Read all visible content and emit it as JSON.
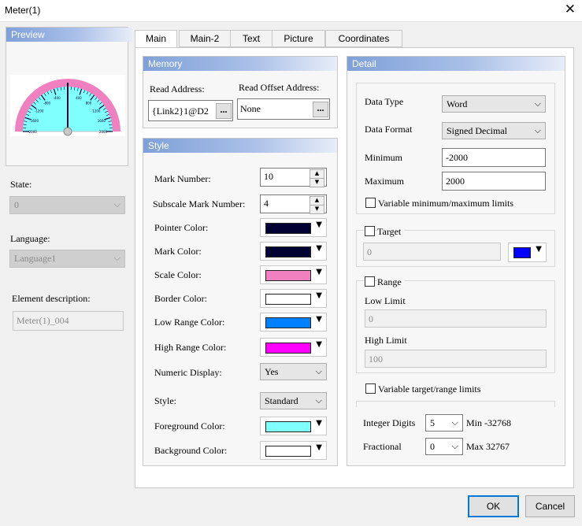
{
  "window": {
    "title": "Meter(1)"
  },
  "left": {
    "preview_title": "Preview",
    "state_label": "State:",
    "state_value": "0",
    "language_label": "Language:",
    "language_value": "Language1",
    "element_desc_label": "Element description:",
    "element_desc_value": "Meter(1)_004",
    "gauge_ticks": [
      "-2000",
      "-1600",
      "-1200",
      "-800",
      "-400",
      "0",
      "400",
      "800",
      "1200",
      "1600",
      "2000"
    ]
  },
  "tabs": [
    "Main",
    "Main-2",
    "Text",
    "Picture",
    "Coordinates"
  ],
  "memory": {
    "title": "Memory",
    "read_address_label": "Read Address:",
    "read_address_value": "{Link2}1@D2",
    "read_offset_label": "Read Offset Address:",
    "read_offset_value": "None",
    "dots": "..."
  },
  "style": {
    "title": "Style",
    "mark_number_label": "Mark Number:",
    "mark_number_value": "10",
    "subscale_label": "Subscale Mark Number:",
    "subscale_value": "4",
    "pointer_color_label": "Pointer Color:",
    "mark_color_label": "Mark Color:",
    "scale_color_label": "Scale Color:",
    "border_color_label": "Border Color:",
    "low_range_color_label": "Low Range Color:",
    "high_range_color_label": "High Range Color:",
    "numeric_display_label": "Numeric Display:",
    "numeric_display_value": "Yes",
    "style_label": "Style:",
    "style_value": "Standard",
    "foreground_color_label": "Foreground Color:",
    "background_color_label": "Background Color:"
  },
  "colors": {
    "pointer": "#000033",
    "mark": "#000033",
    "scale": "#f080c0",
    "border": "#ffffff",
    "low_range": "#0080ff",
    "high_range": "#ff00ff",
    "foreground": "#80ffff",
    "background": "#ffffff",
    "target": "#0000ff",
    "header_accent": "#7fa0d8"
  },
  "detail": {
    "title": "Detail",
    "data_type_label": "Data Type",
    "data_type_value": "Word",
    "data_format_label": "Data Format",
    "data_format_value": "Signed Decimal",
    "minimum_label": "Minimum",
    "minimum_value": "-2000",
    "maximum_label": "Maximum",
    "maximum_value": "2000",
    "var_minmax_label": "Variable minimum/maximum limits",
    "target_label": "Target",
    "target_value": "0",
    "range_label": "Range",
    "low_limit_label": "Low Limit",
    "low_limit_value": "0",
    "high_limit_label": "High Limit",
    "high_limit_value": "100",
    "var_target_label": "Variable target/range limits",
    "integer_digits_label": "Integer Digits",
    "integer_digits_value": "5",
    "integer_digits_hint": "Min -32768",
    "fractional_label": "Fractional",
    "fractional_value": "0",
    "fractional_hint": "Max 32767"
  },
  "buttons": {
    "ok": "OK",
    "cancel": "Cancel"
  }
}
